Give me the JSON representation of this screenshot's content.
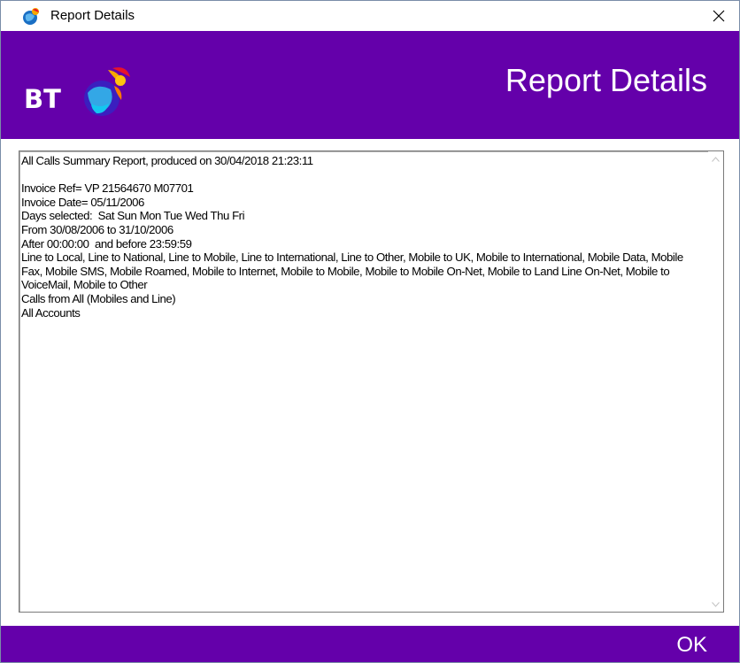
{
  "window": {
    "title": "Report Details",
    "close_glyph": "✕"
  },
  "header": {
    "logo_text": "BT",
    "title": "Report Details",
    "background_color": "#6400aa"
  },
  "report": {
    "lines": [
      "All Calls Summary Report, produced on 30/04/2018 21:23:11",
      "",
      "Invoice Ref= VP 21564670 M07701",
      "Invoice Date= 05/11/2006",
      "Days selected:  Sat Sun Mon Tue Wed Thu Fri",
      "From 30/08/2006 to 31/10/2006",
      "After 00:00:00  and before 23:59:59",
      "Line to Local, Line to National, Line to Mobile, Line to International, Line to Other, Mobile to UK, Mobile to International, Mobile Data, Mobile Fax, Mobile SMS, Mobile Roamed, Mobile to Internet, Mobile to Mobile, Mobile to Mobile On-Net, Mobile to Land Line On-Net, Mobile to VoiceMail, Mobile to Other",
      "Calls from All (Mobiles and Line)",
      "All Accounts"
    ]
  },
  "footer": {
    "ok_label": "OK"
  }
}
